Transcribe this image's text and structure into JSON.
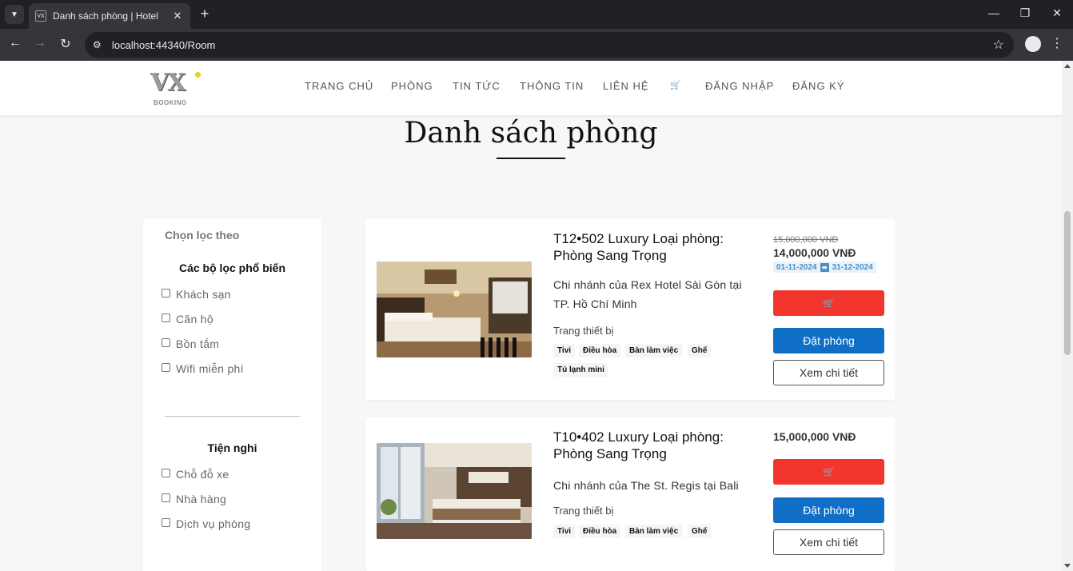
{
  "browser": {
    "tab_title": "Danh sách phòng | Hotel",
    "tab_favicon_text": "VX",
    "tab_close": "✕",
    "new_tab": "+",
    "url": "localhost:44340/Room",
    "window_controls": {
      "minimize": "—",
      "restore": "❐",
      "close": "✕"
    },
    "nav": {
      "back": "←",
      "forward": "→",
      "reload": "↻"
    },
    "star": "☆",
    "menu": "⋮"
  },
  "site": {
    "logo_mark": "VX",
    "logo_sub": "BOOKING",
    "nav": [
      "TRANG CHỦ",
      "PHÒNG",
      "TIN TỨC",
      "THÔNG TIN",
      "LIÊN HỆ",
      "🛒",
      "ĐĂNG NHẬP",
      "ĐĂNG KÝ"
    ]
  },
  "page": {
    "title": "Danh sách phòng"
  },
  "filters": {
    "heading": "Chọn lọc theo",
    "popular_title": "Các bộ lọc phổ biến",
    "popular": [
      "Khách sạn",
      "Căn hộ",
      "Bồn tắm",
      "Wifi miễn phí"
    ],
    "amenities_title": "Tiện nghi",
    "amenities": [
      "Chỗ đỗ xe",
      "Nhà hàng",
      "Dịch vụ phòng"
    ]
  },
  "rooms": [
    {
      "name": "T12•502 Luxury Loại phòng: Phòng Sang Trọng",
      "branch": "Chi nhánh của Rex Hotel Sài Gòn tại TP. Hồ Chí Minh",
      "equipment_label": "Trang thiết bị",
      "equipment": [
        "Tivi",
        "Điều hòa",
        "Bàn làm việc",
        "Ghế",
        "Tủ lạnh mini"
      ],
      "old_price": "15,000,000 VNĐ",
      "price": "14,000,000 VNĐ",
      "date_from": "01-11-2024",
      "date_to": "31-12-2024",
      "cart_label": "🛒",
      "book_label": "Đặt phòng",
      "detail_label": "Xem chi tiết"
    },
    {
      "name": "T10•402 Luxury Loại phòng: Phòng Sang Trọng",
      "branch": "Chi nhánh của The St. Regis tại Bali",
      "equipment_label": "Trang thiết bị",
      "equipment": [
        "Tivi",
        "Điều hòa",
        "Bàn làm việc",
        "Ghế"
      ],
      "price": "15,000,000 VNĐ",
      "cart_label": "🛒",
      "book_label": "Đặt phòng",
      "detail_label": "Xem chi tiết"
    }
  ],
  "colors": {
    "cart_button": "#f2362d",
    "book_button": "#0f6fc6",
    "date_badge": "#4a90c6"
  }
}
